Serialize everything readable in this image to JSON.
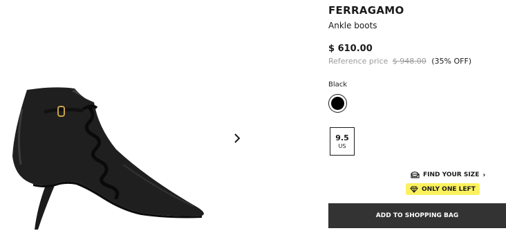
{
  "gallery": {
    "image_alt_icon": "black-ankle-boot-image",
    "next_icon": "chevron-right-icon"
  },
  "product": {
    "brand": "FERRAGAMO",
    "name": "Ankle boots",
    "price": "$ 610.00",
    "reference_label": "Reference price",
    "reference_price": "$ 948.00",
    "discount": "(35% OFF)"
  },
  "color": {
    "label": "Black",
    "value": "#000000"
  },
  "size": {
    "value": "9.5",
    "unit": "US"
  },
  "find_size": {
    "label": "FIND YOUR SIZE",
    "icon": "measuring-tape-icon",
    "chevron": "›"
  },
  "stock_badge": {
    "label": "ONLY ONE LEFT",
    "icon": "diamond-icon",
    "color": "#fbf15e"
  },
  "cta": {
    "label": "ADD TO SHOPPING BAG",
    "color": "#333333"
  }
}
